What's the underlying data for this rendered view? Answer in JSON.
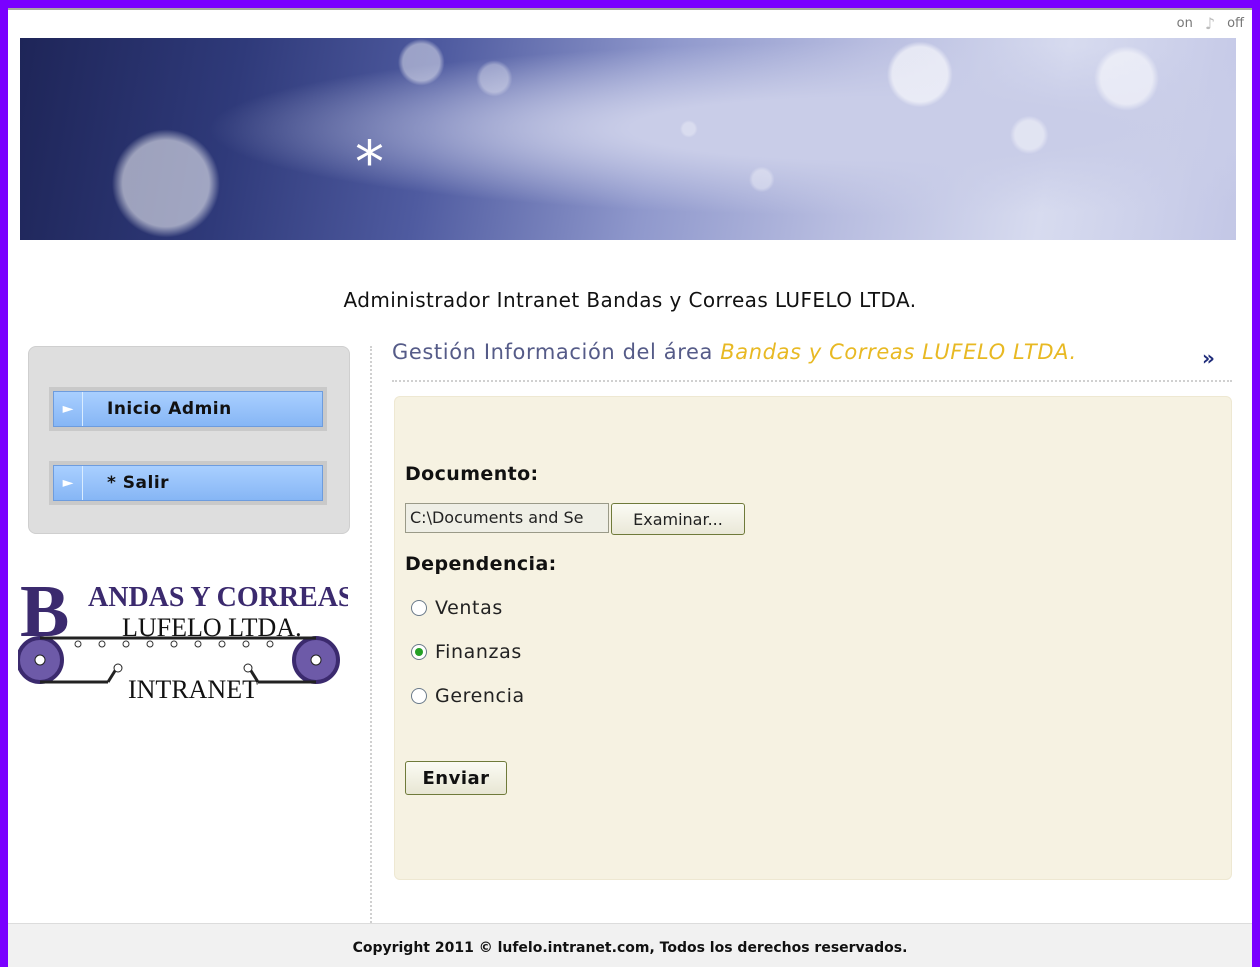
{
  "audio": {
    "on_label": "on",
    "off_label": "off"
  },
  "site_title": "Administrador Intranet Bandas y Correas LUFELO LTDA.",
  "sidebar": {
    "items": [
      {
        "label": "Inicio Admin",
        "icon": "play-arrow-icon"
      },
      {
        "label": "* Salir",
        "icon": "play-arrow-icon"
      }
    ]
  },
  "logo": {
    "line1": "ANDAS Y CORREAS",
    "line2": "LUFELO LTDA.",
    "line3": "INTRANET",
    "initial": "B",
    "color": "#3b2a6e"
  },
  "main": {
    "title_prefix": "Gestión Información del área ",
    "title_highlight": "Bandas y Correas LUFELO LTDA.",
    "form": {
      "document_label": "Documento:",
      "file_value": "C:\\Documents and Se",
      "browse_label": "Examinar...",
      "dependency_label": "Dependencia:",
      "options": [
        {
          "label": "Ventas",
          "checked": false
        },
        {
          "label": "Finanzas",
          "checked": true
        },
        {
          "label": "Gerencia",
          "checked": false
        }
      ],
      "submit_label": "Enviar"
    }
  },
  "footer": {
    "text": "Copyright 2011 © lufelo.intranet.com, Todos los derechos reservados."
  },
  "colors": {
    "frame": "#7a00ff",
    "accent_title": "#555b88",
    "highlight": "#e8b923",
    "panel": "#f6f2e2",
    "nav": "#86b6f5"
  }
}
